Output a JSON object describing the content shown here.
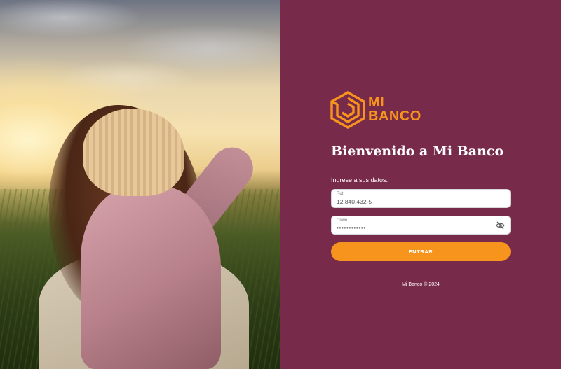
{
  "brand": {
    "logo_line1": "MI",
    "logo_line2": "BANCO",
    "accent_color": "#f7941d",
    "panel_color": "#782a4a"
  },
  "login": {
    "welcome_title": "Bienvenido a Mi Banco",
    "instructions": "Ingrese a sus datos.",
    "rut_label": "Rut",
    "rut_value": "12.840.432-5",
    "clave_label": "Clave",
    "clave_value": "••••••••••••",
    "toggle_visibility_icon": "eye-off-icon",
    "submit_label": "ENTRAR"
  },
  "footer": {
    "copyright": "Mi Banco © 2024"
  }
}
